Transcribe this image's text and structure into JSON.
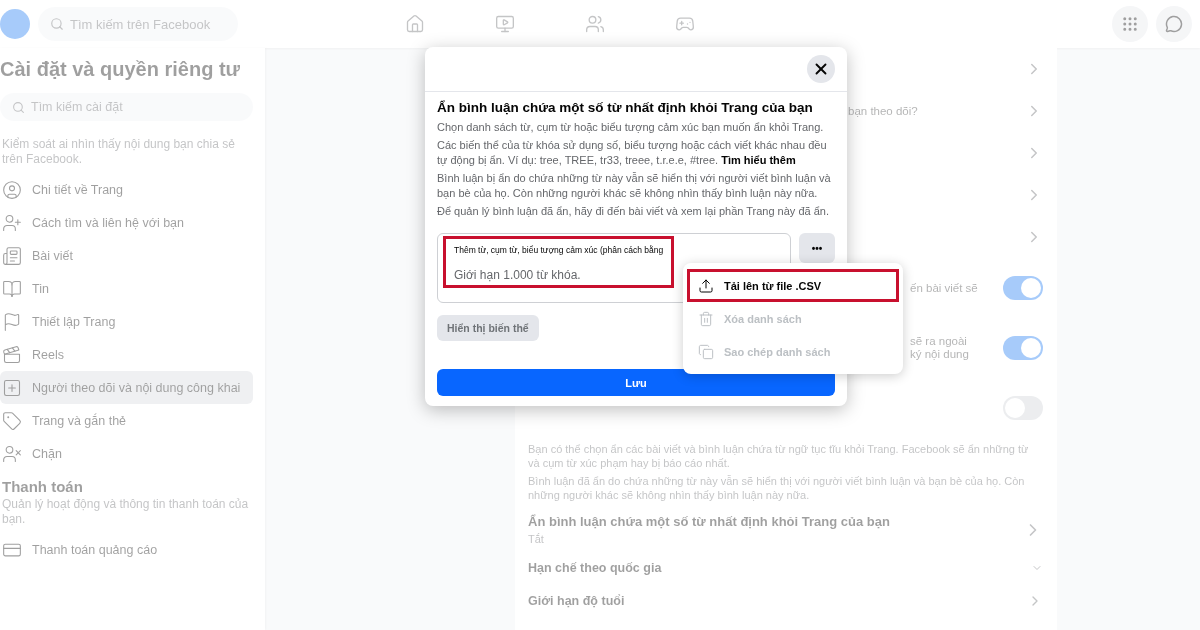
{
  "topbar": {
    "search": {
      "placeholder": "Tìm kiếm trên Facebook"
    }
  },
  "sidebar": {
    "title": "Cài đặt và quyền riêng tư",
    "search": {
      "placeholder": "Tìm kiếm cài đặt"
    },
    "description": "Kiểm soát ai nhìn thấy nội dung bạn chia sẻ trên Facebook.",
    "items": [
      {
        "label": "Chi tiết về Trang",
        "selected": false
      },
      {
        "label": "Cách tìm và liên hệ với bạn",
        "selected": false
      },
      {
        "label": "Bài viết",
        "selected": false
      },
      {
        "label": "Tin",
        "selected": false
      },
      {
        "label": "Thiết lập Trang",
        "selected": false
      },
      {
        "label": "Reels",
        "selected": false
      },
      {
        "label": "Người theo dõi và nội dung công khai",
        "selected": true
      },
      {
        "label": "Trang và gắn thẻ",
        "selected": false
      },
      {
        "label": "Chặn",
        "selected": false
      }
    ],
    "payment": {
      "title": "Thanh toán",
      "description": "Quản lý hoạt động và thông tin thanh toán của bạn.",
      "items": [
        {
          "label": "Thanh toán quảng cáo",
          "selected": false
        }
      ]
    }
  },
  "main": {
    "rows": [
      {
        "kind": "link"
      },
      {
        "kind": "link",
        "text": "bạn theo dõi?"
      },
      {
        "kind": "link"
      },
      {
        "kind": "link"
      },
      {
        "kind": "link"
      },
      {
        "kind": "toggle",
        "on": true,
        "text": "ến bài viết sẽ"
      },
      {
        "kind": "toggle",
        "on": true,
        "text": "sẽ ra ngoài\nký nội dung"
      },
      {
        "kind": "toggle",
        "on": false
      }
    ],
    "paragraphs": [
      "Bạn có thể chọn ẩn các bài viết và bình luận chứa từ ngữ tục tĩu khỏi Trang. Facebook sẽ ẩn những từ và cụm từ xúc phạm hay bị báo cáo nhất.",
      "Bình luận đã ẩn do chứa những từ này vẫn sẽ hiển thị với người viết bình luận và bạn bè của họ. Còn những người khác sẽ không nhìn thấy bình luận này nữa."
    ],
    "setting": {
      "title": "Ẩn bình luận chứa một số từ nhất định khỏi Trang của bạn",
      "value": "Tắt"
    },
    "sections": [
      {
        "title": "Hạn chế theo quốc gia",
        "kind": "dropdown"
      },
      {
        "title": "Giới hạn độ tuổi",
        "kind": "link"
      }
    ]
  },
  "dialog": {
    "title": "Ẩn bình luận chứa một số từ nhất định khỏi Trang của bạn",
    "paragraphs": [
      "Chọn danh sách từ, cụm từ hoặc biểu tượng cảm xúc bạn muốn ẩn khỏi Trang.",
      "Các biến thể của từ khóa sử dụng số, biểu tượng hoặc cách viết khác nhau đều tự động bị ẩn. Ví dụ: tree, TREE, tr33, treee, t.r.e.e, #tree.",
      "Bình luận bị ẩn do chứa những từ này vẫn sẽ hiển thị với người viết bình luận và bạn bè của họ. Còn những người khác sẽ không nhìn thấy bình luận này nữa.",
      "Để quản lý bình luận đã ẩn, hãy đi đến bài viết và xem lại phần Trang này đã ẩn."
    ],
    "learn_more": "Tìm hiểu thêm",
    "field": {
      "label": "Thêm từ, cụm từ, biểu tượng cảm xúc (phân cách bằng",
      "placeholder": "Giới hạn 1.000 từ khóa.",
      "highlighted": true
    },
    "more_button": "•••",
    "variants_button": {
      "label": "Hiển thị biến thể",
      "disabled": true
    },
    "save_button": "Lưu",
    "menu": [
      {
        "label": "Tải lên từ file .CSV",
        "disabled": false,
        "highlighted": true
      },
      {
        "label": "Xóa danh sách",
        "disabled": true,
        "highlighted": false
      },
      {
        "label": "Sao chép danh sách",
        "disabled": true,
        "highlighted": false
      }
    ]
  }
}
